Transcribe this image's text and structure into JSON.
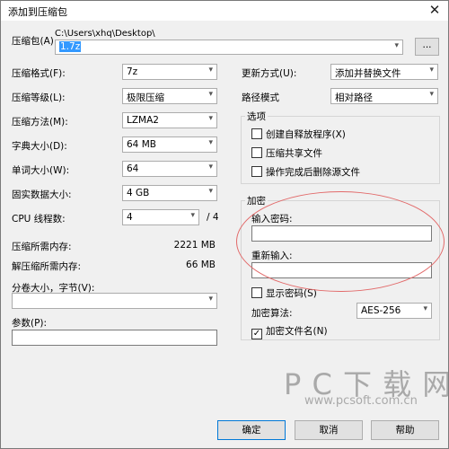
{
  "window": {
    "title": "添加到压缩包",
    "close_glyph": "✕"
  },
  "archive": {
    "label": "压缩包(A)",
    "path": "C:\\Users\\xhq\\Desktop\\",
    "filename": "1.7z",
    "browse_label": "..."
  },
  "left": {
    "format": {
      "label": "压缩格式(F):",
      "value": "7z"
    },
    "level": {
      "label": "压缩等级(L):",
      "value": "极限压缩"
    },
    "method": {
      "label": "压缩方法(M):",
      "value": "LZMA2"
    },
    "dict": {
      "label": "字典大小(D):",
      "value": "64 MB"
    },
    "word": {
      "label": "单词大小(W):",
      "value": "64"
    },
    "solid": {
      "label": "固实数据大小:",
      "value": "4 GB"
    },
    "cpu": {
      "label": "CPU 线程数:",
      "value": "4",
      "max": "/ 4"
    },
    "mem_compress": {
      "label": "压缩所需内存:",
      "value": "2221 MB"
    },
    "mem_decompress": {
      "label": "解压缩所需内存:",
      "value": "66 MB"
    },
    "split": {
      "label": "分卷大小，字节(V):",
      "value": ""
    },
    "params": {
      "label": "参数(P):",
      "value": ""
    }
  },
  "right": {
    "update": {
      "label": "更新方式(U):",
      "value": "添加并替换文件"
    },
    "pathmode": {
      "label": "路径模式",
      "value": "相对路径"
    },
    "options": {
      "title": "选项",
      "items": [
        {
          "label": "创建自释放程序(X)",
          "checked": false
        },
        {
          "label": "压缩共享文件",
          "checked": false
        },
        {
          "label": "操作完成后删除源文件",
          "checked": false
        }
      ]
    },
    "encryption": {
      "title": "加密",
      "password_label": "输入密码:",
      "reenter_label": "重新输入:",
      "show_password": {
        "label": "显示密码(S)",
        "checked": false
      },
      "method_label": "加密算法:",
      "method_value": "AES-256",
      "encrypt_names": {
        "label": "加密文件名(N)",
        "checked": true,
        "mark": "✓"
      }
    }
  },
  "buttons": {
    "ok": "确定",
    "cancel": "取消",
    "help": "帮助"
  },
  "watermark": {
    "big": "P C 下 载 网",
    "url": "www.pcsoft.com.cn"
  },
  "colors": {
    "annotation": "#e26a6a",
    "selection": "#3399ff"
  },
  "icons": {
    "dropdown": "▾"
  }
}
